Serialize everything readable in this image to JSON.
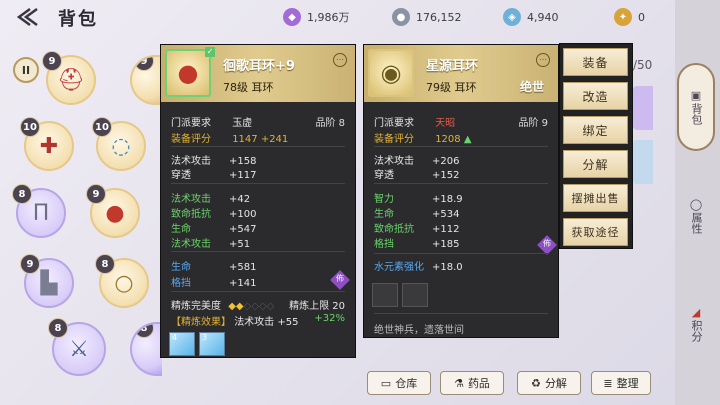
{
  "header": {
    "title": "背包"
  },
  "currencies": [
    {
      "value": "1,986万",
      "color": "#a26bd6",
      "icon": "purple-crystal-icon"
    },
    {
      "value": "176,152",
      "color": "#8a93a6",
      "icon": "silver-coin-icon"
    },
    {
      "value": "4,940",
      "color": "#6fb0d8",
      "icon": "blue-gem-icon"
    },
    {
      "value": "0",
      "color": "#d8a43a",
      "icon": "gold-token-icon"
    }
  ],
  "inventory": {
    "pause_label": "II",
    "slots": [
      {
        "level": "9",
        "icon": "helmet-icon"
      },
      {
        "level": "9",
        "icon": "helmet-icon"
      },
      {
        "level": "10",
        "icon": "armor-icon"
      },
      {
        "level": "10",
        "icon": "necklace-icon"
      },
      {
        "level": "8",
        "icon": "pants-icon"
      },
      {
        "level": "9",
        "icon": "earring-icon"
      },
      {
        "level": "9",
        "icon": "boots-icon"
      },
      {
        "level": "8",
        "icon": "ring-icon"
      },
      {
        "level": "8",
        "icon": "weapon-icon"
      },
      {
        "level": "8",
        "icon": "orb-icon"
      }
    ],
    "capacity_partial": "/50"
  },
  "left_panel": {
    "name": "徊歌耳环+9",
    "level_type": "78级  耳环",
    "school_label": "门派要求",
    "school_value": "玉虚",
    "grade": "品阶 8",
    "score_label": "装备评分",
    "score_value": "1147 +241",
    "base": [
      {
        "k": "法术攻击",
        "v": "+158"
      },
      {
        "k": "穿透",
        "v": "+117"
      }
    ],
    "bonus": [
      {
        "k": "法术攻击",
        "v": "+42"
      },
      {
        "k": "致命抵抗",
        "v": "+100"
      },
      {
        "k": "生命",
        "v": "+547"
      },
      {
        "k": "法术攻击",
        "v": "+51"
      }
    ],
    "extra": [
      {
        "k": "生命",
        "v": "+581"
      },
      {
        "k": "格挡",
        "v": "+141"
      }
    ],
    "seal": "佈",
    "refine_label": "精炼完美度",
    "refine_limit": "精炼上限 20",
    "effect_label": "【精炼效果】",
    "effect_value": "法术攻击 +55",
    "effect_pct": "+32%",
    "gems": [
      {
        "count": "4"
      },
      {
        "count": "3"
      }
    ]
  },
  "right_panel": {
    "name": "星源耳环",
    "level_type": "79级  耳环",
    "tag": "绝世",
    "school_label": "门派要求",
    "school_value": "天昭",
    "grade": "品阶 9",
    "score_label": "装备评分",
    "score_value": "1208",
    "base": [
      {
        "k": "法术攻击",
        "v": "+206"
      },
      {
        "k": "穿透",
        "v": "+152"
      }
    ],
    "bonus": [
      {
        "k": "智力",
        "v": "+18.9"
      },
      {
        "k": "生命",
        "v": "+534"
      },
      {
        "k": "致命抵抗",
        "v": "+112"
      },
      {
        "k": "格挡",
        "v": "+185"
      }
    ],
    "seal": "佈",
    "water_label": "水元素强化",
    "water_value": "+18.0",
    "flavor": "绝世神兵，遗落世间"
  },
  "actions": [
    "装备",
    "改造",
    "绑定",
    "分解",
    "摆摊出售",
    "获取途径"
  ],
  "rail": [
    {
      "label": "背包"
    },
    {
      "label": "属性"
    },
    {
      "label": "积分"
    }
  ],
  "bottom": [
    {
      "label": "仓库",
      "icon": "chest-icon"
    },
    {
      "label": "药品",
      "icon": "potion-icon"
    },
    {
      "label": "分解",
      "icon": "recycle-icon"
    },
    {
      "label": "整理",
      "icon": "stack-icon"
    }
  ]
}
